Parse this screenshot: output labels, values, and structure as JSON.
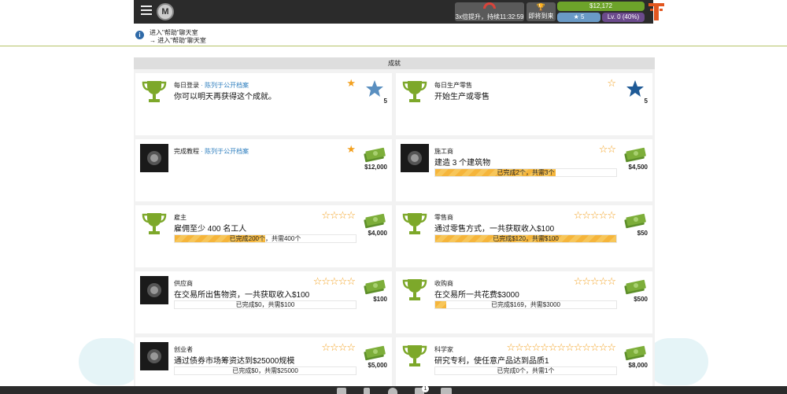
{
  "top_bar": {
    "logo_letter": "M",
    "boost_text": "3x倍提升，持续11:32:59",
    "coming_soon": "即将到来",
    "money": "$12,172",
    "stars": "5",
    "level": "Lv. 0 (40%)"
  },
  "notice": {
    "line1": "进入\"帮助\"聊天室",
    "line2": "→ 进入\"帮助\"聊天室"
  },
  "section": {
    "title": "成就"
  },
  "cards": [
    {
      "title": "每日登录",
      "public": " · 陈列于公开档案",
      "desc": "你可以明天再获得这个成就。",
      "stars": "★",
      "reward_value": "5",
      "reward_kind": "star"
    },
    {
      "title": "每日生产零售",
      "public": "",
      "desc": "开始生产或零售",
      "stars": "☆",
      "reward_value": "5",
      "reward_kind": "star-dark"
    },
    {
      "title": "完成教程",
      "public": " · 陈列于公开档案",
      "desc": "",
      "stars": "★",
      "reward_value": "$12,000",
      "reward_kind": "cash"
    },
    {
      "title": "施工商",
      "public": "",
      "desc": "建造 3 个建筑物",
      "stars": "☆☆",
      "reward_value": "$4,500",
      "reward_kind": "cash",
      "progress": {
        "text": "已完成2个，共需3个",
        "fraction": 0.667
      }
    },
    {
      "title": "雇主",
      "public": "",
      "desc": "雇佣至少 400 名工人",
      "stars": "☆☆☆☆",
      "reward_value": "$4,000",
      "reward_kind": "cash",
      "progress": {
        "text": "已完成200个，共需400个",
        "fraction": 0.5
      }
    },
    {
      "title": "零售商",
      "public": "",
      "desc": "通过零售方式，一共获取收入$100",
      "stars": "☆☆☆☆☆",
      "reward_value": "$50",
      "reward_kind": "cash",
      "progress": {
        "text": "已完成$120，共需$100",
        "fraction": 1.0
      }
    },
    {
      "title": "供应商",
      "public": "",
      "desc": "在交易所出售物资，一共获取收入$100",
      "stars": "☆☆☆☆☆",
      "reward_value": "$100",
      "reward_kind": "cash",
      "progress": {
        "text": "已完成$0，共需$100",
        "fraction": 0.0
      }
    },
    {
      "title": "收购商",
      "public": "",
      "desc": "在交易所一共花费$3000",
      "stars": "☆☆☆☆☆",
      "reward_value": "$500",
      "reward_kind": "cash",
      "progress": {
        "text": "已完成$169，共需$3000",
        "fraction": 0.056
      }
    },
    {
      "title": "创业者",
      "public": "",
      "desc": "通过债券市场筹资达到$25000规模",
      "stars": "☆☆☆☆",
      "reward_value": "$5,000",
      "reward_kind": "cash",
      "progress": {
        "text": "已完成$0，共需$25000",
        "fraction": 0.0
      }
    },
    {
      "title": "科学家",
      "public": "",
      "desc": "研究专利，使任意产品达到品质1",
      "stars": "☆☆☆☆☆☆☆☆☆☆☆☆☆",
      "reward_value": "$8,000",
      "reward_kind": "cash",
      "progress": {
        "text": "已完成0个，共需1个",
        "fraction": 0.0
      }
    }
  ],
  "bottom_bar": {
    "chat_count": "1"
  },
  "colors": {
    "accent_orange": "#f3a01e",
    "money_green": "#6da32a",
    "level_purple": "#6b4a8c",
    "link_blue": "#2f7fbf"
  }
}
